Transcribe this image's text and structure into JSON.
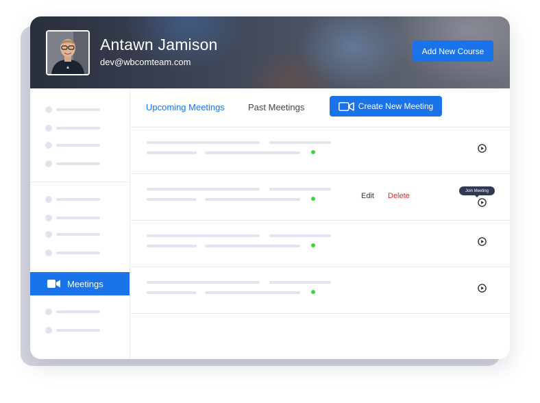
{
  "profile": {
    "name": "Antawn Jamison",
    "email": "dev@wbcomteam.com",
    "add_course_label": "Add New Course"
  },
  "sidebar": {
    "active_label": "Meetings",
    "active_icon": "video-camera-icon"
  },
  "tabs": {
    "upcoming": "Upcoming Meetings",
    "past": "Past Meetings",
    "create_label": "Create New Meeting"
  },
  "meetings": {
    "row_actions": {
      "edit": "Edit",
      "delete": "Delete",
      "tooltip": "Join Meeting"
    }
  },
  "colors": {
    "accent": "#1a73e8",
    "delete": "#e02424",
    "online": "#3fcf3f",
    "placeholder": "#e1e4ee"
  }
}
